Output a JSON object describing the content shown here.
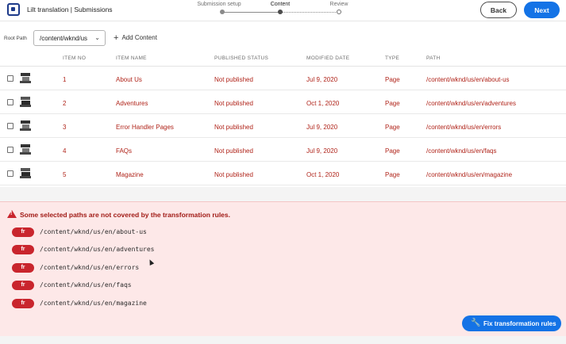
{
  "header": {
    "app_title": "Lilt translation | Submissions",
    "steps": [
      {
        "label": "Submission setup",
        "state": "done"
      },
      {
        "label": "Content",
        "state": "current"
      },
      {
        "label": "Review",
        "state": "todo"
      }
    ],
    "back_label": "Back",
    "next_label": "Next"
  },
  "toolbar": {
    "root_path_label": "Root Path",
    "root_path_value": "/content/wknd/us",
    "add_content_label": "Add Content"
  },
  "table": {
    "columns": [
      "ITEM NO",
      "ITEM NAME",
      "PUBLISHED STATUS",
      "MODIFIED DATE",
      "TYPE",
      "PATH"
    ],
    "rows": [
      {
        "no": "1",
        "name": "About Us",
        "status": "Not published",
        "date": "Jul 9, 2020",
        "type": "Page",
        "path": "/content/wknd/us/en/about-us"
      },
      {
        "no": "2",
        "name": "Adventures",
        "status": "Not published",
        "date": "Oct 1, 2020",
        "type": "Page",
        "path": "/content/wknd/us/en/adventures"
      },
      {
        "no": "3",
        "name": "Error Handler Pages",
        "status": "Not published",
        "date": "Jul 9, 2020",
        "type": "Page",
        "path": "/content/wknd/us/en/errors"
      },
      {
        "no": "4",
        "name": "FAQs",
        "status": "Not published",
        "date": "Jul 9, 2020",
        "type": "Page",
        "path": "/content/wknd/us/en/faqs"
      },
      {
        "no": "5",
        "name": "Magazine",
        "status": "Not published",
        "date": "Oct 1, 2020",
        "type": "Page",
        "path": "/content/wknd/us/en/magazine"
      }
    ]
  },
  "warning": {
    "message": "Some selected paths are not covered by the transformation rules.",
    "items": [
      {
        "lang": "fr",
        "path": "/content/wknd/us/en/about-us"
      },
      {
        "lang": "fr",
        "path": "/content/wknd/us/en/adventures"
      },
      {
        "lang": "fr",
        "path": "/content/wknd/us/en/errors"
      },
      {
        "lang": "fr",
        "path": "/content/wknd/us/en/faqs"
      },
      {
        "lang": "fr",
        "path": "/content/wknd/us/en/magazine"
      }
    ],
    "fix_label": "Fix transformation rules"
  },
  "icons": {
    "logo": "lilt-logo-icon",
    "add": "plus-icon",
    "dropdown": "chevron-down-icon",
    "warning": "alert-triangle-icon",
    "fix": "wrench-icon",
    "thumbnail": "page-thumbnail-icon"
  },
  "colors": {
    "accent": "#1473e6",
    "error_text": "#b0241a",
    "warning_bg": "#fde8e8",
    "badge": "#c9252d"
  }
}
